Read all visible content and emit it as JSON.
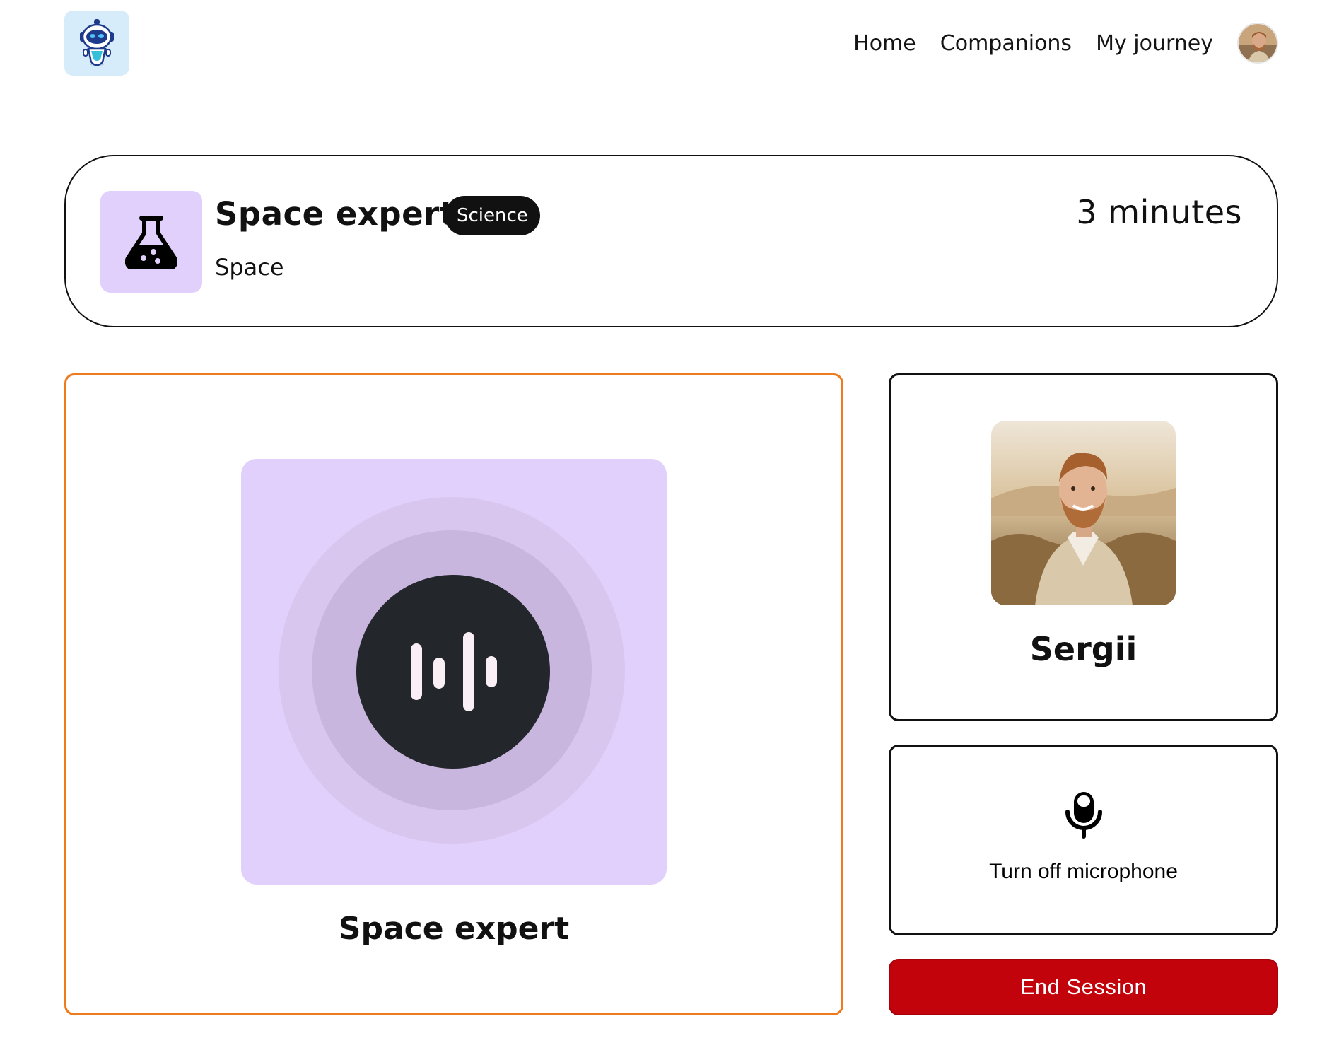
{
  "nav": {
    "logo_icon": "robot-icon",
    "links": [
      "Home",
      "Companions",
      "My journey"
    ],
    "avatar_icon": "user-avatar"
  },
  "session": {
    "companion_name": "Space expert",
    "subject": "Science",
    "topic": "Space",
    "duration": "3 minutes",
    "subject_icon": "flask-icon",
    "subject_color": "#E1D0FB"
  },
  "companion_panel": {
    "name": "Space expert",
    "visualizer_icon": "soundwave-icon",
    "border_color": "#EF7A1C"
  },
  "user_panel": {
    "name": "Sergii"
  },
  "mic": {
    "label": "Turn off microphone",
    "icon": "microphone-icon"
  },
  "end_session": {
    "label": "End Session",
    "color": "#C2030B"
  }
}
